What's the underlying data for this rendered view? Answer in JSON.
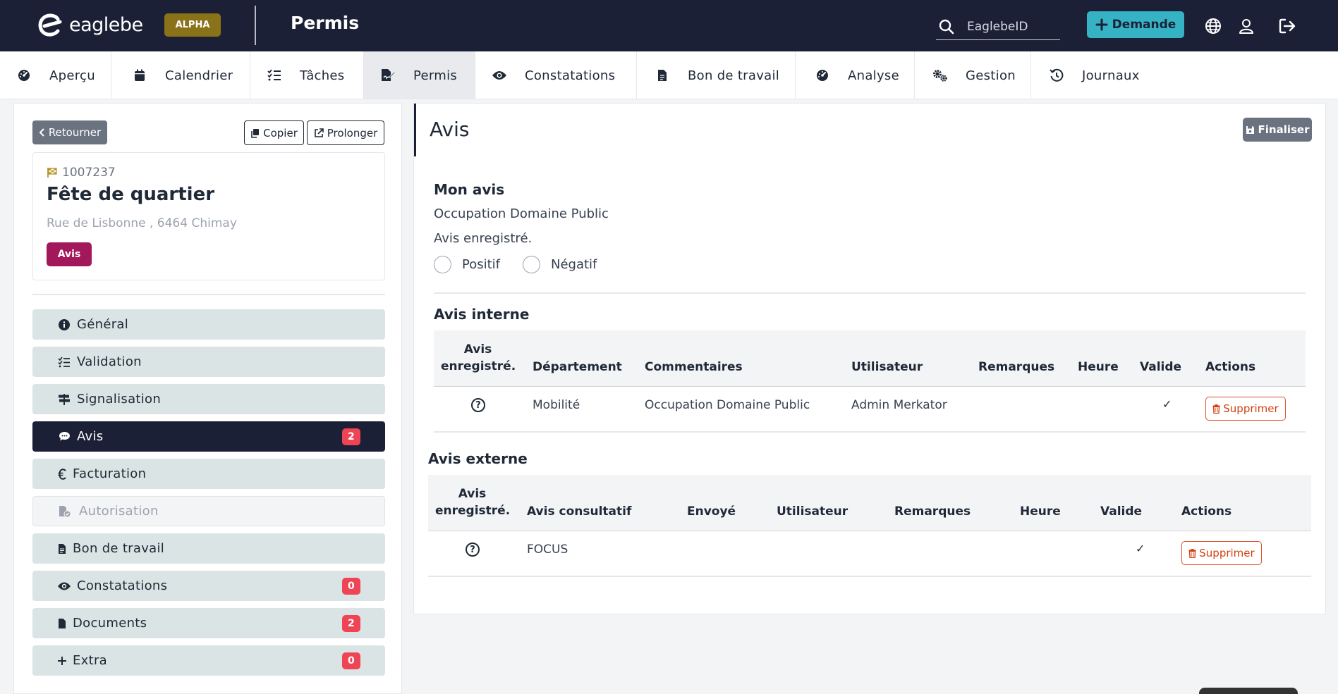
{
  "header": {
    "logo_text": "eaglebe",
    "alpha_badge": "ALPHA",
    "app_title": "Permis",
    "search_placeholder": "EaglebeID",
    "demande_button": "Demande",
    "brand_color": "#1b2036",
    "accent_color": "#35b3c4"
  },
  "tabs": [
    {
      "label": "Aperçu",
      "icon": "gauge-icon"
    },
    {
      "label": "Calendrier",
      "icon": "calendar-icon"
    },
    {
      "label": "Tâches",
      "icon": "checklist-icon"
    },
    {
      "label": "Permis",
      "icon": "sign-document-icon",
      "active": true
    },
    {
      "label": "Constatations",
      "icon": "eye-icon"
    },
    {
      "label": "Bon de travail",
      "icon": "file-icon"
    },
    {
      "label": "Analyse",
      "icon": "gauge-icon"
    },
    {
      "label": "Gestion",
      "icon": "gears-icon"
    },
    {
      "label": "Journaux",
      "icon": "history-icon"
    }
  ],
  "left": {
    "back_button": "Retourner",
    "copy_button": "Copier",
    "extend_button": "Prolonger",
    "card": {
      "id": "1007237",
      "title": "Fête de quartier",
      "address": "Rue de Lisbonne , 6464 Chimay",
      "status": "Avis"
    },
    "menu": [
      {
        "label": "Général",
        "icon": "info-icon"
      },
      {
        "label": "Validation",
        "icon": "checklist-icon"
      },
      {
        "label": "Signalisation",
        "icon": "signs-icon"
      },
      {
        "label": "Avis",
        "icon": "comment-icon",
        "count": "2",
        "active": true
      },
      {
        "label": "Facturation",
        "icon": "euro-icon"
      },
      {
        "label": "Autorisation",
        "icon": "file-check-icon",
        "disabled": true
      },
      {
        "label": "Bon de travail",
        "icon": "file-icon"
      },
      {
        "label": "Constatations",
        "icon": "eye-icon",
        "count": "0"
      },
      {
        "label": "Documents",
        "icon": "file-icon",
        "count": "2"
      },
      {
        "label": "Extra",
        "icon": "plus-icon",
        "count": "0"
      }
    ]
  },
  "main": {
    "title": "Avis",
    "finalize_button": "Finaliser",
    "mon_avis": {
      "heading": "Mon avis",
      "subject": "Occupation Domaine Public",
      "status": "Avis enregistré.",
      "options": [
        "Positif",
        "Négatif"
      ]
    },
    "avis_interne": {
      "heading": "Avis interne",
      "columns": [
        "Avis enregistré.",
        "Département",
        "Commentaires",
        "Utilisateur",
        "Remarques",
        "Heure",
        "Valide",
        "Actions"
      ],
      "rows": [
        {
          "departement": "Mobilité",
          "commentaires": "Occupation Domaine Public",
          "utilisateur": "Admin Merkator",
          "remarques": "",
          "heure": "",
          "valide": "✓",
          "action": "Supprimer"
        }
      ]
    },
    "avis_externe": {
      "heading": "Avis externe",
      "columns": [
        "Avis enregistré.",
        "Avis consultatif",
        "Envoyé",
        "Utilisateur",
        "Remarques",
        "Heure",
        "Valide",
        "Actions"
      ],
      "rows": [
        {
          "consultatif": "FOCUS",
          "envoye": "",
          "utilisateur": "",
          "remarques": "",
          "heure": "",
          "valide": "✓",
          "action": "Supprimer"
        }
      ]
    }
  }
}
